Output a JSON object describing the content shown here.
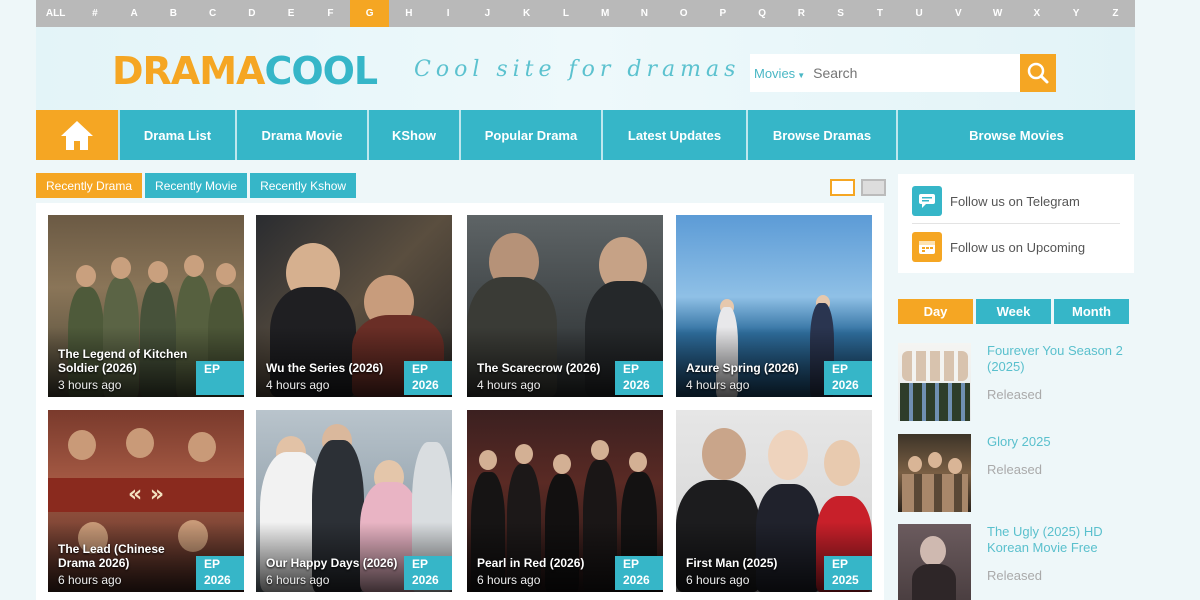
{
  "alphabet": {
    "letters": [
      "ALL",
      "#",
      "A",
      "B",
      "C",
      "D",
      "E",
      "F",
      "G",
      "H",
      "I",
      "J",
      "K",
      "L",
      "M",
      "N",
      "O",
      "P",
      "Q",
      "R",
      "S",
      "T",
      "U",
      "V",
      "W",
      "X",
      "Y",
      "Z"
    ],
    "active": "G"
  },
  "header": {
    "logo_part1": "DRAMA",
    "logo_part2": "COOL",
    "tagline": "Cool site for dramas",
    "search": {
      "type": "Movies",
      "placeholder": "Search"
    }
  },
  "nav": {
    "items": [
      "Drama List",
      "Drama Movie",
      "KShow",
      "Popular Drama",
      "Latest Updates",
      "Browse Dramas",
      "Browse Movies"
    ]
  },
  "tabs": [
    "Recently Drama",
    "Recently Movie",
    "Recently Kshow"
  ],
  "cards": [
    {
      "title": "The Legend of Kitchen Soldier (2026)",
      "time": "3 hours ago",
      "ep": "EP",
      "year": ""
    },
    {
      "title": "Wu the Series (2026)",
      "time": "4 hours ago",
      "ep": "EP",
      "year": "2026"
    },
    {
      "title": "The Scarecrow (2026)",
      "time": "4 hours ago",
      "ep": "EP",
      "year": "2026"
    },
    {
      "title": "Azure Spring (2026)",
      "time": "4 hours ago",
      "ep": "EP",
      "year": "2026"
    },
    {
      "title": "The Lead (Chinese Drama 2026)",
      "time": "6 hours ago",
      "ep": "EP",
      "year": "2026"
    },
    {
      "title": "Our Happy Days (2026)",
      "time": "6 hours ago",
      "ep": "EP",
      "year": "2026"
    },
    {
      "title": "Pearl in Red (2026)",
      "time": "6 hours ago",
      "ep": "EP",
      "year": "2026"
    },
    {
      "title": "First Man (2025)",
      "time": "6 hours ago",
      "ep": "EP",
      "year": "2025"
    }
  ],
  "follow": {
    "telegram": "Follow us on Telegram",
    "upcoming": "Follow us on Upcoming"
  },
  "range_tabs": [
    "Day",
    "Week",
    "Month"
  ],
  "ranking": [
    {
      "title": "Fourever You Season 2 (2025)",
      "status": "Released"
    },
    {
      "title": "Glory 2025",
      "status": "Released"
    },
    {
      "title": "The Ugly (2025) HD Korean Movie Free",
      "status": "Released"
    }
  ],
  "colors": {
    "accent_orange": "#f5a623",
    "accent_teal": "#36b6c8",
    "alpha_bar": "#b9b9b9"
  }
}
